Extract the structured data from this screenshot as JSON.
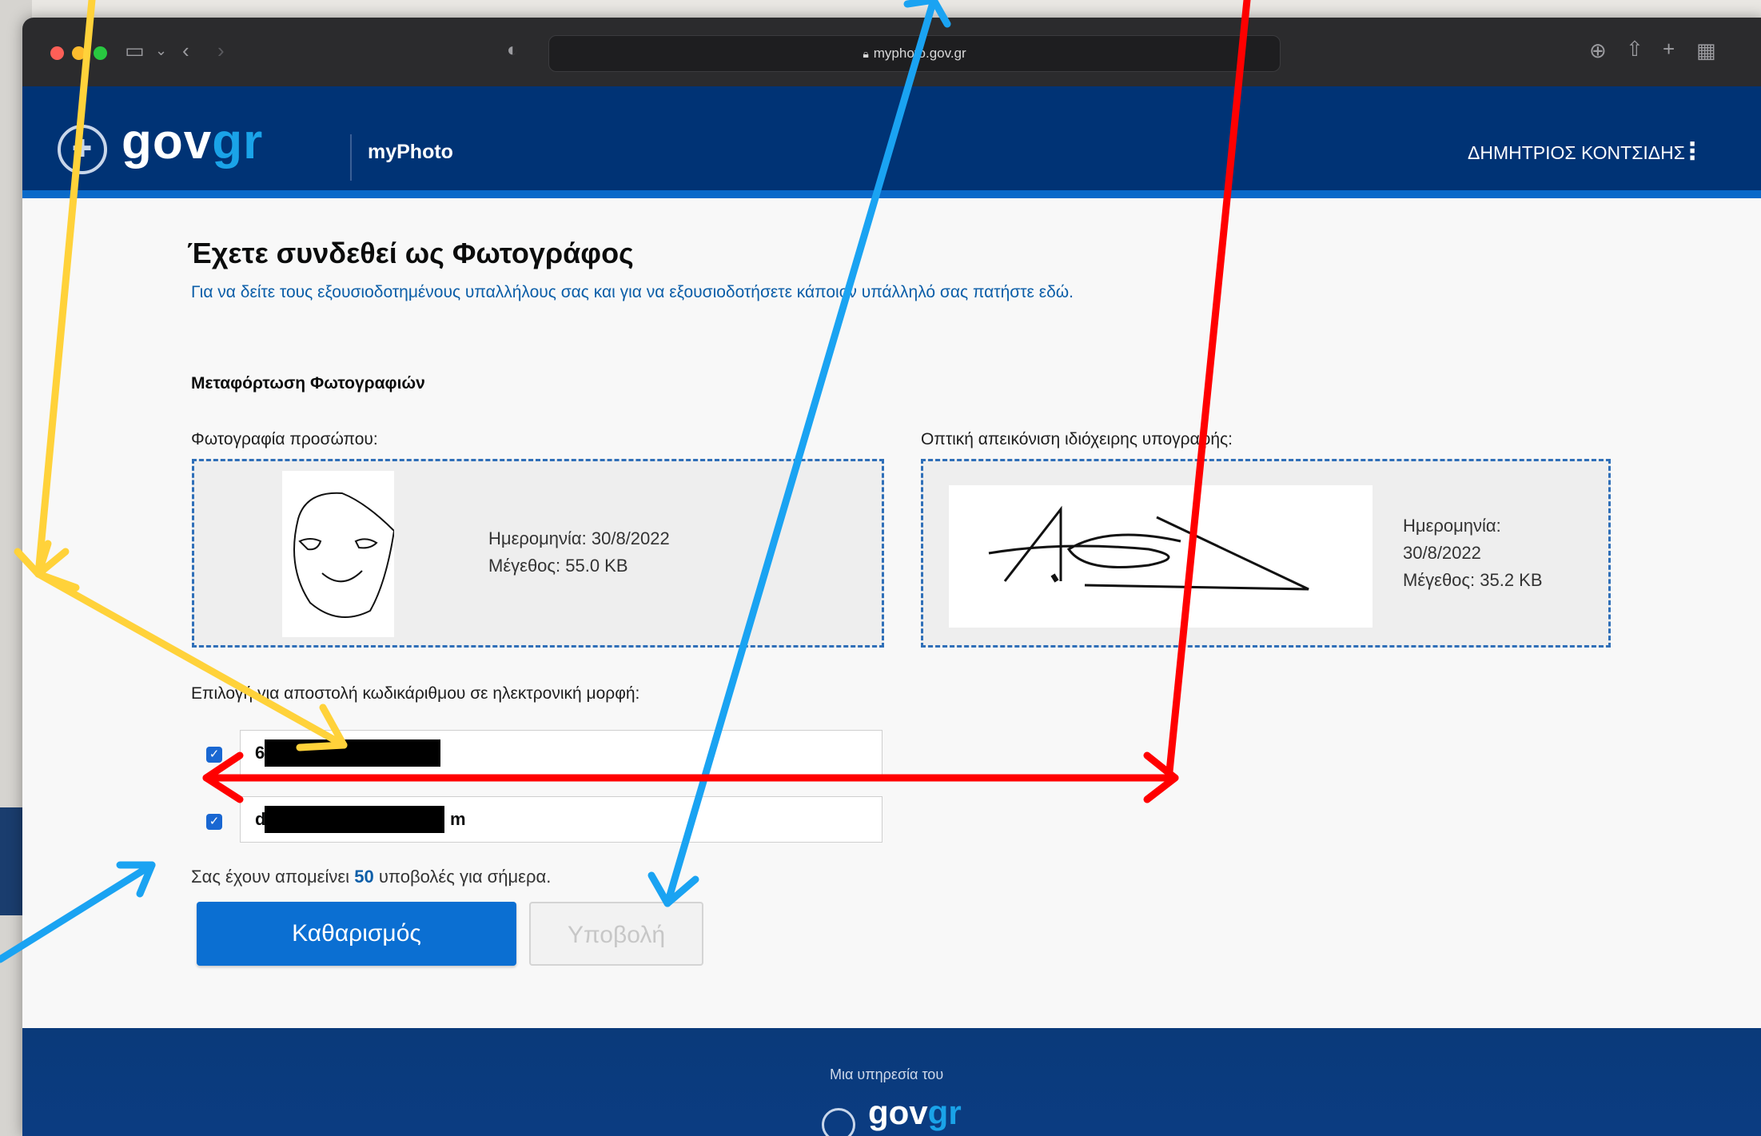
{
  "browser": {
    "url": "myphoto.gov.gr",
    "icons": [
      "sidebar-icon",
      "chevron-down-icon",
      "back-icon",
      "forward-icon",
      "shield-icon",
      "download-icon",
      "share-icon",
      "new-tab-icon",
      "tab-overview-icon"
    ]
  },
  "header": {
    "logo_gov": "gov",
    "logo_gr": "gr",
    "service": "myPhoto",
    "user": "ΔΗΜΗΤΡΙΟΣ ΚΟΝΤΣΙΔΗΣ",
    "menu_icon": "⋮"
  },
  "main": {
    "title": "Έχετε συνδεθεί ως Φωτογράφος",
    "intro_link": "Για να δείτε τους εξουσιοδοτημένους υπαλλήλους σας και για να εξουσιοδοτήσετε κάποιον υπάλληλό σας πατήστε εδώ.",
    "section_title": "Μεταφόρτωση Φωτογραφιών",
    "face": {
      "label": "Φωτογραφία προσώπου:",
      "date": "Ημερομηνία: 30/8/2022",
      "size": "Μέγεθος: 55.0 KB"
    },
    "signature": {
      "label": "Οπτική απεικόνιση ιδιόχειρης υπογραφής:",
      "date_label": "Ημερομηνία:",
      "date": "30/8/2022",
      "size": "Μέγεθος: 35.2 KB"
    },
    "contact_label": "Επιλογή για αποστολή κωδικάριθμου σε ηλεκτρονική μορφή:",
    "phone_prefix": "6",
    "email_prefix": "d",
    "email_suffix": "m",
    "quota_pre": "Σας έχουν απομείνει",
    "quota_count": "50",
    "quota_post": "υποβολές για σήμερα.",
    "clear_button": "Καθαρισμός",
    "submit_button": "Υποβολή"
  },
  "footer": {
    "text": "Μια υπηρεσία του",
    "logo_gov": "gov",
    "logo_gr": "gr"
  },
  "colors": {
    "header_bg": "#003375",
    "accent": "#0b6fd2",
    "arrow_yellow": "#ffd23a",
    "arrow_blue": "#1aa3f2",
    "arrow_red": "#ff0000"
  }
}
